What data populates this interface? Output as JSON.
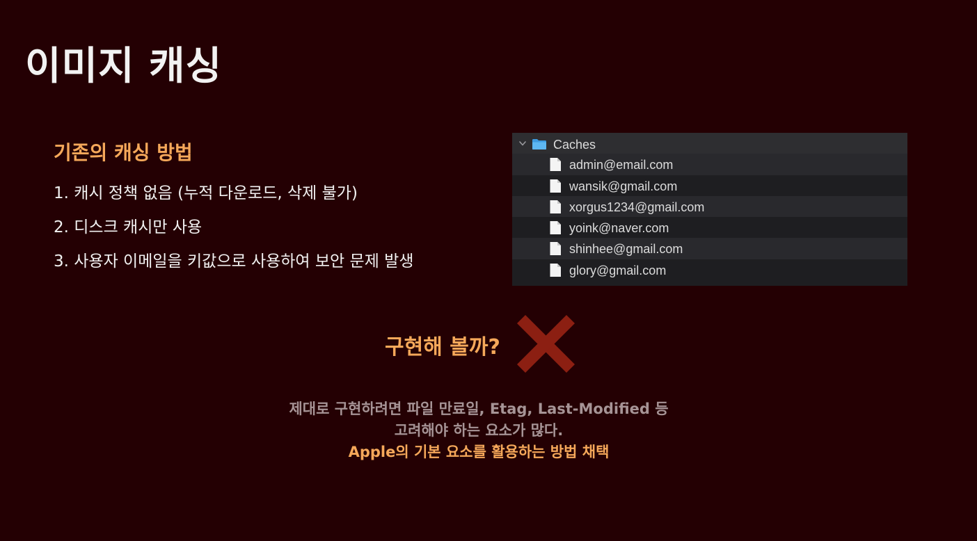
{
  "slide": {
    "title": "이미지 캐싱"
  },
  "section": {
    "heading": "기존의 캐싱 방법",
    "points": [
      "1. 캐시 정책 없음 (누적 다운로드, 삭제 불가)",
      "2. 디스크 캐시만 사용",
      "3. 사용자 이메일을 키값으로 사용하여 보안 문제 발생"
    ]
  },
  "finder": {
    "folder": {
      "name": "Caches",
      "icon": "folder-icon",
      "disclosure_icon": "chevron-down-icon",
      "expanded": true
    },
    "files": [
      "admin@email.com",
      "wansik@gmail.com",
      "xorgus1234@gmail.com",
      "yoink@naver.com",
      "shinhee@gmail.com",
      "glory@gmail.com"
    ],
    "file_icon": "file-icon"
  },
  "question": {
    "text": "구현해 볼까?",
    "mark_icon": "cross-icon"
  },
  "conclusion": {
    "line1": "제대로 구현하려면 파일 만료일, Etag, Last-Modified 등",
    "line2": "고려해야 하는 요소가 많다.",
    "line3": "Apple의 기본 요소를 활용하는 방법 채택"
  },
  "colors": {
    "background": "#240003",
    "accent": "#f5a85a",
    "cross": "#8c1f12",
    "muted_text": "#a69496",
    "finder_background": "#1e1e21",
    "finder_alt_row": "#29292d",
    "folder_blue": "#5eb7f2"
  }
}
